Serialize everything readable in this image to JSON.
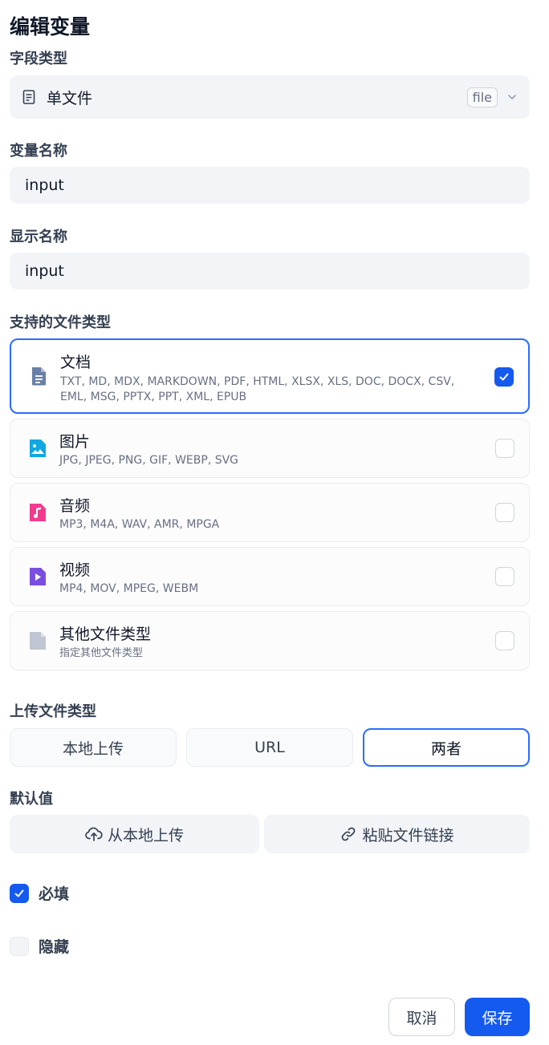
{
  "title": "编辑变量",
  "field_type": {
    "label": "字段类型",
    "value": "单文件",
    "badge": "file",
    "icon": "document-outline-icon"
  },
  "variable_name": {
    "label": "变量名称",
    "value": "input"
  },
  "display_name": {
    "label": "显示名称",
    "value": "input"
  },
  "supported_types": {
    "label": "支持的文件类型",
    "items": [
      {
        "name": "文档",
        "desc": "TXT, MD, MDX, MARKDOWN, PDF, HTML, XLSX, XLS, DOC, DOCX, CSV, EML, MSG, PPTX, PPT, XML, EPUB",
        "checked": true,
        "icon": "document-icon",
        "color": "#6a7fa8"
      },
      {
        "name": "图片",
        "desc": "JPG, JPEG, PNG, GIF, WEBP, SVG",
        "checked": false,
        "icon": "image-icon",
        "color": "#11a7e0"
      },
      {
        "name": "音频",
        "desc": "MP3, M4A, WAV, AMR, MPGA",
        "checked": false,
        "icon": "audio-icon",
        "color": "#f23a8e"
      },
      {
        "name": "视频",
        "desc": "MP4, MOV, MPEG, WEBM",
        "checked": false,
        "icon": "video-icon",
        "color": "#7a4fe0"
      },
      {
        "name": "其他文件类型",
        "desc": "指定其他文件类型",
        "checked": false,
        "icon": "file-icon",
        "color": "#c0c6d4"
      }
    ]
  },
  "upload_method": {
    "label": "上传文件类型",
    "options": [
      "本地上传",
      "URL",
      "两者"
    ],
    "selected": "两者"
  },
  "default_value": {
    "label": "默认值",
    "upload_local": "从本地上传",
    "paste_link": "粘贴文件链接"
  },
  "required": {
    "label": "必填",
    "checked": true
  },
  "hidden": {
    "label": "隐藏",
    "checked": false
  },
  "actions": {
    "cancel": "取消",
    "save": "保存"
  },
  "colors": {
    "accent": "#155aef",
    "accent_border": "#296dff"
  }
}
